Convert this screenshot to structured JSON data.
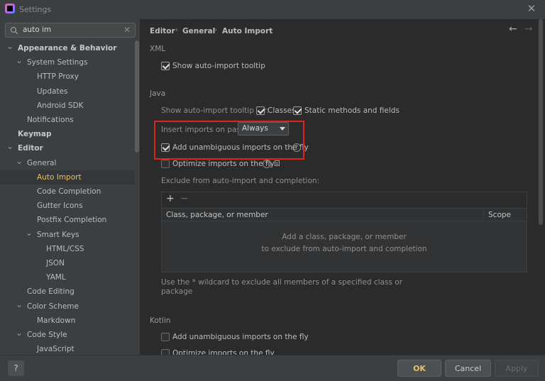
{
  "window": {
    "title": "Settings",
    "close": "✕"
  },
  "search": {
    "value": "auto im",
    "clear": "✕"
  },
  "tree": [
    {
      "label": "Appearance & Behavior",
      "bold": true,
      "chevron": "v",
      "indent": 0
    },
    {
      "label": "System Settings",
      "bold": false,
      "chevron": "v",
      "indent": 1
    },
    {
      "label": "HTTP Proxy",
      "bold": false,
      "chevron": "",
      "indent": 2
    },
    {
      "label": "Updates",
      "bold": false,
      "chevron": "",
      "indent": 2
    },
    {
      "label": "Android SDK",
      "bold": false,
      "chevron": "",
      "indent": 2
    },
    {
      "label": "Notifications",
      "bold": false,
      "chevron": "",
      "indent": 1
    },
    {
      "label": "Keymap",
      "bold": true,
      "chevron": "",
      "indent": 0
    },
    {
      "label": "Editor",
      "bold": true,
      "chevron": "v",
      "indent": 0
    },
    {
      "label": "General",
      "bold": false,
      "chevron": "v",
      "indent": 1
    },
    {
      "label": "Auto Import",
      "bold": false,
      "chevron": "",
      "indent": 2,
      "selected": true
    },
    {
      "label": "Code Completion",
      "bold": false,
      "chevron": "",
      "indent": 2
    },
    {
      "label": "Gutter Icons",
      "bold": false,
      "chevron": "",
      "indent": 2
    },
    {
      "label": "Postfix Completion",
      "bold": false,
      "chevron": "",
      "indent": 2
    },
    {
      "label": "Smart Keys",
      "bold": false,
      "chevron": "v",
      "indent": 2
    },
    {
      "label": "HTML/CSS",
      "bold": false,
      "chevron": "",
      "indent": 3
    },
    {
      "label": "JSON",
      "bold": false,
      "chevron": "",
      "indent": 3
    },
    {
      "label": "YAML",
      "bold": false,
      "chevron": "",
      "indent": 3
    },
    {
      "label": "Code Editing",
      "bold": false,
      "chevron": "",
      "indent": 1
    },
    {
      "label": "Color Scheme",
      "bold": false,
      "chevron": "v",
      "indent": 1
    },
    {
      "label": "Markdown",
      "bold": false,
      "chevron": "",
      "indent": 2
    },
    {
      "label": "Code Style",
      "bold": false,
      "chevron": "v",
      "indent": 1
    },
    {
      "label": "JavaScript",
      "bold": false,
      "chevron": "",
      "indent": 2
    }
  ],
  "breadcrumb": {
    "part1": "Editor",
    "part2": "General",
    "part3": "Auto Import",
    "sep": "›",
    "back": "←",
    "forward": "→"
  },
  "xml": {
    "section": "XML",
    "show_tooltip": {
      "label": "Show auto-import tooltip",
      "checked": true
    }
  },
  "java": {
    "section": "Java",
    "tooltip_for_label": "Show auto-import tooltip for:",
    "classes": {
      "label": "Classes",
      "checked": true
    },
    "static_methods": {
      "label": "Static methods and fields",
      "checked": true
    },
    "insert_on_paste_label": "Insert imports on paste:",
    "insert_on_paste_value": "Always",
    "add_unambiguous": {
      "label": "Add unambiguous imports on the fly",
      "checked": true
    },
    "optimize": {
      "label": "Optimize imports on the fly",
      "checked": false
    },
    "help_glyph": "?",
    "exclude_label": "Exclude from auto-import and completion:",
    "table": {
      "add": "+",
      "remove": "−",
      "col1": "Class, package, or member",
      "col2": "Scope",
      "empty_line1": "Add a class, package, or member",
      "empty_line2": "to exclude from auto-import and completion"
    },
    "wildcard_note_line1": "Use the * wildcard to exclude all members of a specified class or",
    "wildcard_note_line2": "package"
  },
  "kotlin": {
    "section": "Kotlin",
    "add_unambiguous": {
      "label": "Add unambiguous imports on the fly",
      "checked": false
    },
    "optimize": {
      "label": "Optimize imports on the fly",
      "checked": false
    }
  },
  "footer": {
    "help": "?",
    "ok": "OK",
    "cancel": "Cancel",
    "apply": "Apply"
  }
}
